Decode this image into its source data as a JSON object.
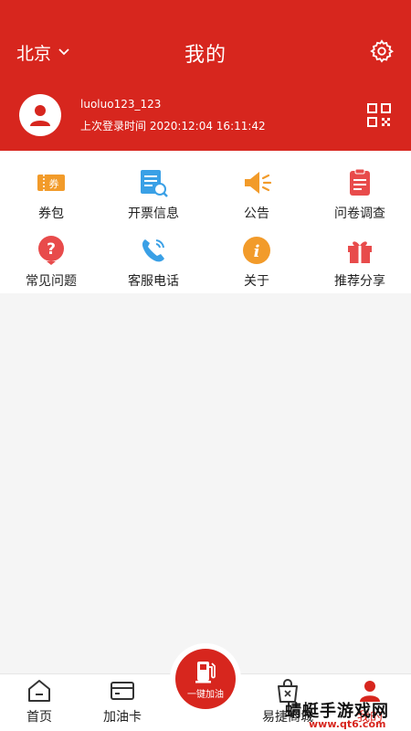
{
  "header": {
    "city": "北京",
    "title": "我的",
    "username": "luoluo123_123",
    "last_login": "上次登录时间 2020:12:04 16:11:42",
    "background": "#d7261e"
  },
  "grid": {
    "items": [
      {
        "label": "券包",
        "icon": "coupon-icon",
        "color": "#f29b2a"
      },
      {
        "label": "开票信息",
        "icon": "invoice-icon",
        "color": "#3aa0e6"
      },
      {
        "label": "公告",
        "icon": "megaphone-icon",
        "color": "#f29b2a"
      },
      {
        "label": "问卷调查",
        "icon": "survey-icon",
        "color": "#e84b4b"
      },
      {
        "label": "常见问题",
        "icon": "question-icon",
        "color": "#e84b4b"
      },
      {
        "label": "客服电话",
        "icon": "phone-icon",
        "color": "#3aa0e6"
      },
      {
        "label": "关于",
        "icon": "info-icon",
        "color": "#f29b2a"
      },
      {
        "label": "推荐分享",
        "icon": "gift-icon",
        "color": "#e84b4b"
      }
    ]
  },
  "tabbar": {
    "tabs": [
      {
        "label": "首页",
        "icon": "home-icon"
      },
      {
        "label": "加油卡",
        "icon": "card-icon"
      },
      {
        "label": "易捷商城",
        "icon": "shop-bag-icon"
      },
      {
        "label": "我的",
        "icon": "profile-icon"
      }
    ],
    "center_label": "一键加油"
  },
  "watermark": {
    "text": "蜻蜓手游戏网",
    "url": "www.qt6.com"
  }
}
